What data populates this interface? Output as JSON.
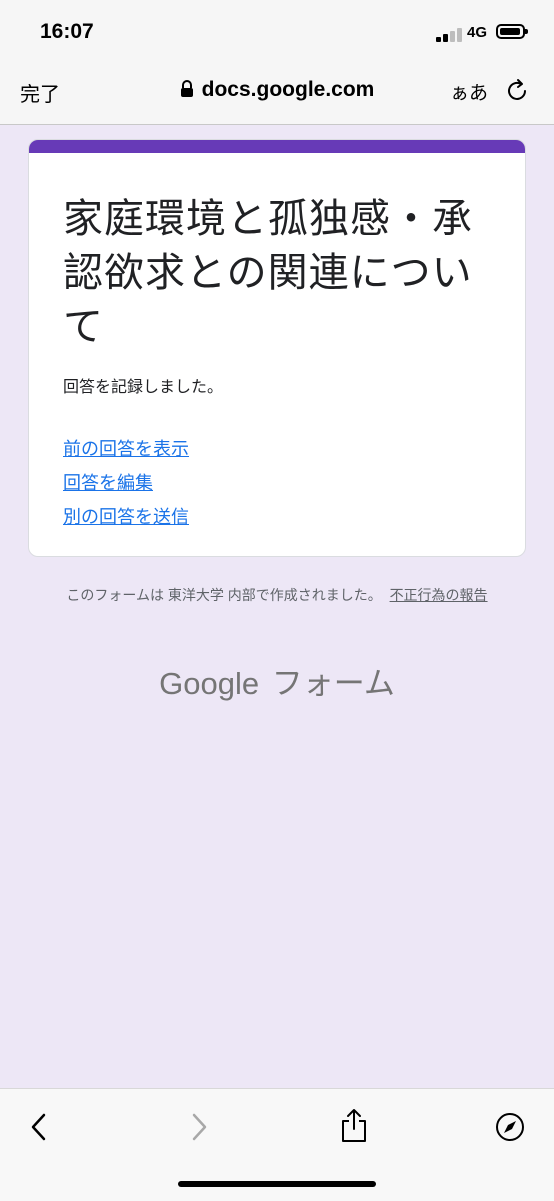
{
  "status": {
    "time": "16:07",
    "network": "4G"
  },
  "browser": {
    "done_label": "完了",
    "url": "docs.google.com",
    "text_size_label": "ぁあ"
  },
  "form": {
    "title": "家庭環境と孤独感・承認欲求との関連について",
    "confirmation": "回答を記録しました。",
    "links": [
      "前の回答を表示",
      "回答を編集",
      "別の回答を送信"
    ]
  },
  "footer": {
    "note": "このフォームは 東洋大学 内部で作成されました。",
    "report_link": "不正行為の報告",
    "brand_google": "Google",
    "brand_forms": "フォーム"
  },
  "colors": {
    "accent": "#673AB7",
    "background": "#EDE7F6",
    "link": "#1A73E8"
  },
  "icons": [
    "lock-icon",
    "reload-icon",
    "back-icon",
    "forward-icon",
    "share-icon",
    "compass-icon"
  ]
}
